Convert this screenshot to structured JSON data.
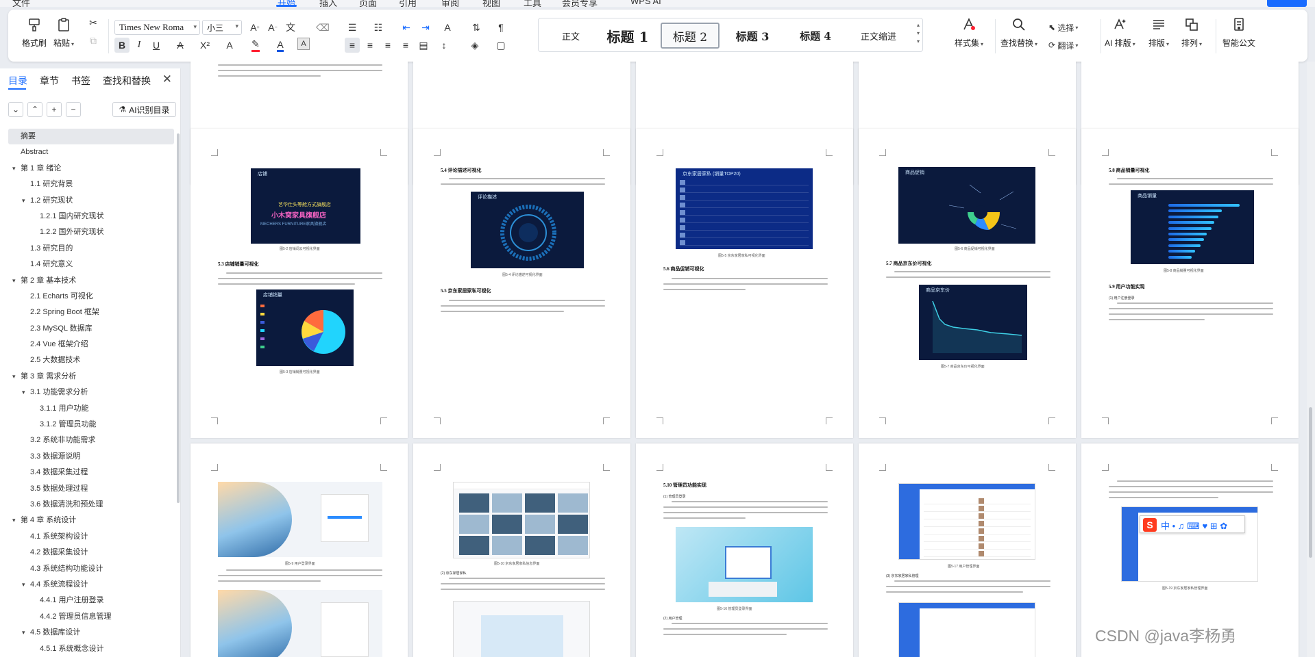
{
  "menubar": {
    "items": [
      "文件",
      "开始",
      "插入",
      "页面",
      "引用",
      "审阅",
      "视图",
      "工具",
      "会员专享",
      "WPS AI"
    ],
    "active_index": 1
  },
  "ribbon": {
    "clipboard": {
      "format_painter": "格式刷",
      "paste": "粘贴"
    },
    "font": {
      "name": "Times New Roma",
      "size": "小三"
    },
    "styles": [
      "正文",
      "标题 1",
      "标题 2",
      "标题 3",
      "标题 4",
      "正文缩进"
    ],
    "selected_style_index": 2,
    "style_set": "样式集",
    "find_replace": "查找替换",
    "select": "选择",
    "translate": "翻译",
    "ai_layout": "AI 排版",
    "layout": "排版",
    "arrange": "排列",
    "smart_doc": "智能公文"
  },
  "nav": {
    "tabs": [
      "目录",
      "章节",
      "书签",
      "查找和替换"
    ],
    "active_tab": 0,
    "ai_button": "AI识别目录",
    "toc": [
      {
        "label": "摘要",
        "level": 0,
        "arrow": "",
        "selected": true
      },
      {
        "label": "Abstract",
        "level": 0,
        "arrow": ""
      },
      {
        "label": "第 1 章 绪论",
        "level": 0,
        "arrow": "▾"
      },
      {
        "label": "1.1 研究背景",
        "level": 1,
        "arrow": ""
      },
      {
        "label": "1.2 研究现状",
        "level": 1,
        "arrow": "▾"
      },
      {
        "label": "1.2.1 国内研究现状",
        "level": 2,
        "arrow": ""
      },
      {
        "label": "1.2.2 国外研究现状",
        "level": 2,
        "arrow": ""
      },
      {
        "label": "1.3 研究目的",
        "level": 1,
        "arrow": ""
      },
      {
        "label": "1.4 研究意义",
        "level": 1,
        "arrow": ""
      },
      {
        "label": "第 2 章 基本技术",
        "level": 0,
        "arrow": "▾"
      },
      {
        "label": "2.1 Echarts 可视化",
        "level": 1,
        "arrow": ""
      },
      {
        "label": "2.2 Spring Boot 框架",
        "level": 1,
        "arrow": ""
      },
      {
        "label": "2.3 MySQL 数据库",
        "level": 1,
        "arrow": ""
      },
      {
        "label": "2.4 Vue 框架介绍",
        "level": 1,
        "arrow": ""
      },
      {
        "label": "2.5 大数据技术",
        "level": 1,
        "arrow": ""
      },
      {
        "label": "第 3 章 需求分析",
        "level": 0,
        "arrow": "▾"
      },
      {
        "label": "3.1 功能需求分析",
        "level": 1,
        "arrow": "▾"
      },
      {
        "label": "3.1.1 用户功能",
        "level": 2,
        "arrow": ""
      },
      {
        "label": "3.1.2 管理员功能",
        "level": 2,
        "arrow": ""
      },
      {
        "label": "3.2 系统非功能需求",
        "level": 1,
        "arrow": ""
      },
      {
        "label": "3.3 数据源说明",
        "level": 1,
        "arrow": ""
      },
      {
        "label": "3.4 数据采集过程",
        "level": 1,
        "arrow": ""
      },
      {
        "label": "3.5 数据处理过程",
        "level": 1,
        "arrow": ""
      },
      {
        "label": "3.6 数据清洗和预处理",
        "level": 1,
        "arrow": ""
      },
      {
        "label": "第 4 章 系统设计",
        "level": 0,
        "arrow": "▾"
      },
      {
        "label": "4.1 系统架构设计",
        "level": 1,
        "arrow": ""
      },
      {
        "label": "4.2 数据采集设计",
        "level": 1,
        "arrow": ""
      },
      {
        "label": "4.3 系统结构功能设计",
        "level": 1,
        "arrow": ""
      },
      {
        "label": "4.4 系统流程设计",
        "level": 1,
        "arrow": "▾"
      },
      {
        "label": "4.4.1 用户注册登录",
        "level": 2,
        "arrow": ""
      },
      {
        "label": "4.4.2 管理员信息管理",
        "level": 2,
        "arrow": ""
      },
      {
        "label": "4.5 数据库设计",
        "level": 1,
        "arrow": "▾"
      },
      {
        "label": "4.5.1 系统概念设计",
        "level": 2,
        "arrow": ""
      }
    ]
  },
  "doc": {
    "row2": {
      "p1": {
        "fig1_title": "店铺",
        "fig1_line1": "艺华仕头等舱方式旗舰店",
        "fig1_line2": "小木窝家具旗舰店",
        "fig1_line3": "MECHERS FURNITURE家具旗舰店",
        "fig1_cap": "图5-2 店铺词云可视化界面",
        "heading": "5.3  店铺销量可视化",
        "fig2_title": "店铺销量",
        "fig2_cap": "图5-3 店铺销量可视化界面"
      },
      "p2": {
        "heading1": "5.4  评论描述可视化",
        "fig_title": "评论描述",
        "fig_cap": "图5-4 评论描述可视化界面",
        "heading2": "5.5  京东家居家私可视化"
      },
      "p3": {
        "fig_title": "京东家居家私 (销量TOP20)",
        "fig_cap": "图5-5 京东家居家私可视化界面",
        "heading": "5.6  商品促销可视化"
      },
      "p4": {
        "fig1_title": "商品促销",
        "fig1_cap": "图5-6 商品促销可视化界面",
        "heading": "5.7  商品京东价可视化",
        "fig2_title": "商品京东价",
        "fig2_cap": "图5-7 商品京东价可视化界面"
      },
      "p5": {
        "heading1": "5.8  商品销量可视化",
        "fig_title": "商品销量",
        "fig_cap": "图5-8 商品销量可视化界面",
        "heading2": "5.9  用户功能实现",
        "sub": "(1) 用户注册登录"
      }
    },
    "row3": {
      "p1": {
        "fig_cap": "图5-9 用户登录界面"
      },
      "p2": {
        "fig_cap": "图5-10 京东家居家私信息界面",
        "sub": "(2) 京东家居家私"
      },
      "p3": {
        "heading": "5.10  管理员功能实现",
        "sub": "(1) 管理员登录",
        "fig_cap": "图5-16 管理员登录界面",
        "sub2": "(2) 用户管理"
      },
      "p4": {
        "fig_cap": "图5-17 用户管理界面",
        "sub": "(3) 京东家居家私管理"
      },
      "p5": {
        "fig_cap": "图5-19 京东家居家私管理界面"
      }
    }
  },
  "watermark": "CSDN @java李杨勇"
}
